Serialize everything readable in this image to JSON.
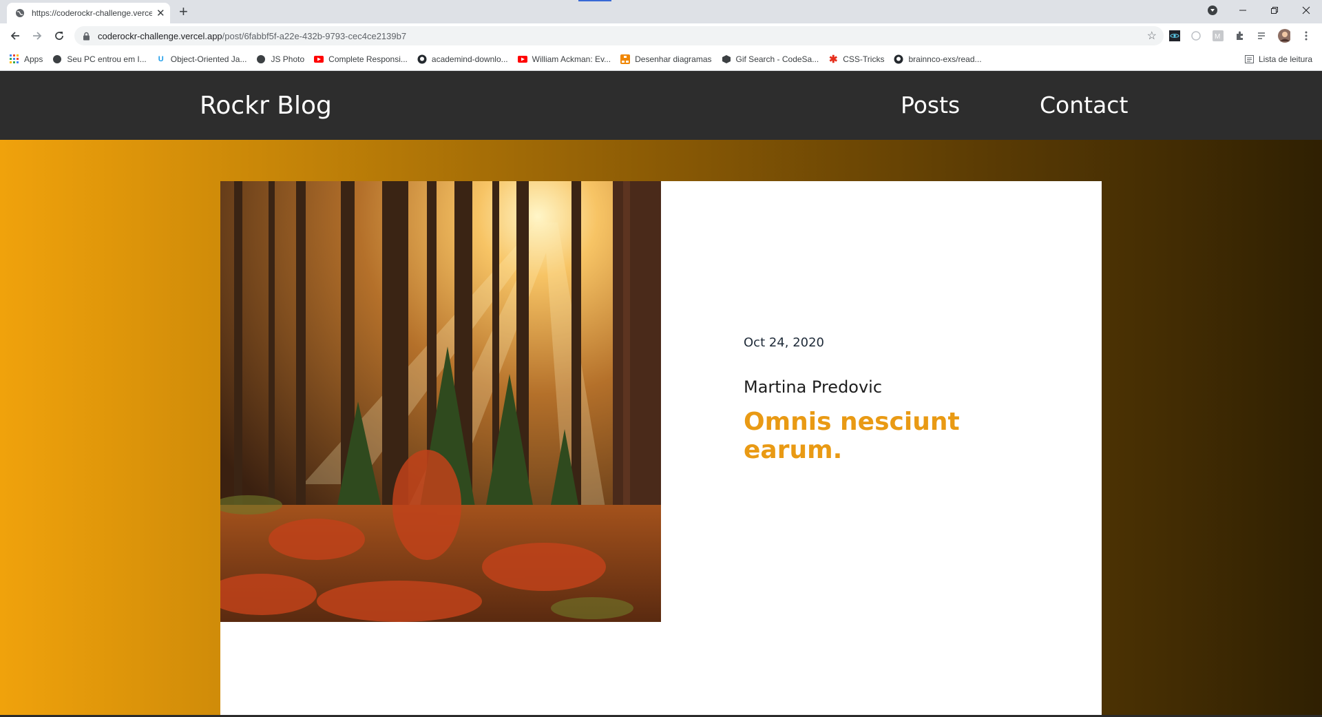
{
  "browser": {
    "tab_title": "https://coderockr-challenge.vercel.app/post/6fabbf5f-a22e-432b-9793-cec4ce2139b7",
    "new_tab": "+",
    "close_tab": "✕",
    "url_host": "coderockr-challenge.vercel.app",
    "url_path": "/post/6fabbf5f-a22e-432b-9793-cec4ce2139b7",
    "bookmarks": [
      {
        "label": "Apps",
        "icon": "apps-grid-icon"
      },
      {
        "label": "Seu PC entrou em I...",
        "icon": "globe-icon"
      },
      {
        "label": "Object-Oriented Ja...",
        "icon": "udemy-icon"
      },
      {
        "label": "JS Photo",
        "icon": "globe-icon"
      },
      {
        "label": "Complete Responsi...",
        "icon": "youtube-icon"
      },
      {
        "label": "academind-downlo...",
        "icon": "github-icon"
      },
      {
        "label": "William Ackman: Ev...",
        "icon": "youtube-icon"
      },
      {
        "label": "Desenhar diagramas",
        "icon": "diagrams-icon"
      },
      {
        "label": "Gif Search - CodeSa...",
        "icon": "codesandbox-icon"
      },
      {
        "label": "CSS-Tricks",
        "icon": "css-tricks-icon"
      },
      {
        "label": "brainnco-exs/read...",
        "icon": "github-icon"
      }
    ],
    "reading_list": "Lista de leitura",
    "accent_colors": {
      "youtube": "#ff0000",
      "udemy": "#1c9cea",
      "css_tricks": "#e62e1c",
      "apps": "#4285f4"
    }
  },
  "site": {
    "brand": "Rockr Blog",
    "nav": [
      {
        "label": "Posts"
      },
      {
        "label": "Contact"
      }
    ],
    "colors": {
      "header_bg": "#2d2d2d",
      "title_orange": "#e99a14"
    }
  },
  "post": {
    "date": "Oct 24, 2020",
    "author": "Martina Predovic",
    "title": "Omnis nesciunt earum.",
    "image": "autumn-forest-sunlight-photo"
  }
}
